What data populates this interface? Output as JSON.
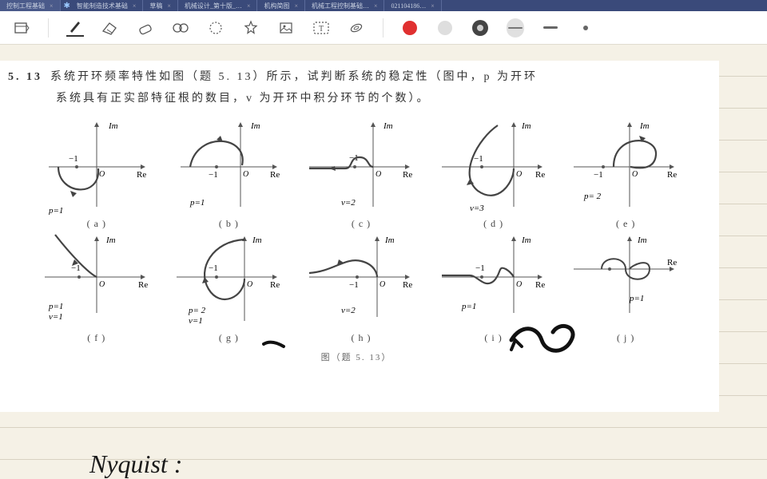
{
  "tabs": [
    {
      "label": "控制工程基础",
      "active": true
    },
    {
      "label": "智能制造技术基础"
    },
    {
      "label": "草稿"
    },
    {
      "label": "机械设计_第十版_…"
    },
    {
      "label": "机构简图"
    },
    {
      "label": "机械工程控制基础…"
    },
    {
      "label": "021104186…"
    }
  ],
  "bluetooth_icon": "✱",
  "toolbar": {
    "tools": [
      "page",
      "pen",
      "eraser-cut",
      "eraser",
      "lasso",
      "selection",
      "shape",
      "image",
      "text",
      "tape"
    ],
    "record_label": "●",
    "size_dash": "—"
  },
  "problem": {
    "number": "5. 13",
    "line1": "系统开环频率特性如图（题 5. 13）所示，试判断系统的稳定性（图中，p 为开环",
    "line2": "系统具有正实部特征根的数目，v 为开环中积分环节的个数）。",
    "axis_im": "Im",
    "axis_re": "Re",
    "origin": "O",
    "minus1": "−1",
    "figure_label": "图（题 5. 13）",
    "subfigs": [
      {
        "cap": "( a )",
        "param": "p=1"
      },
      {
        "cap": "( b )",
        "param": "p=1"
      },
      {
        "cap": "( c )",
        "param": "v=2"
      },
      {
        "cap": "( d )",
        "param": "v=3"
      },
      {
        "cap": "( e )",
        "param": "p= 2"
      },
      {
        "cap": "( f )",
        "param": "p=1\n v=1"
      },
      {
        "cap": "( g )",
        "param": "p= 2\n v=1"
      },
      {
        "cap": "( h )",
        "param": "v=2"
      },
      {
        "cap": "( i )",
        "param": "p=1"
      },
      {
        "cap": "( j )",
        "param": "p=1"
      }
    ]
  },
  "handwriting": "Nyquist :"
}
